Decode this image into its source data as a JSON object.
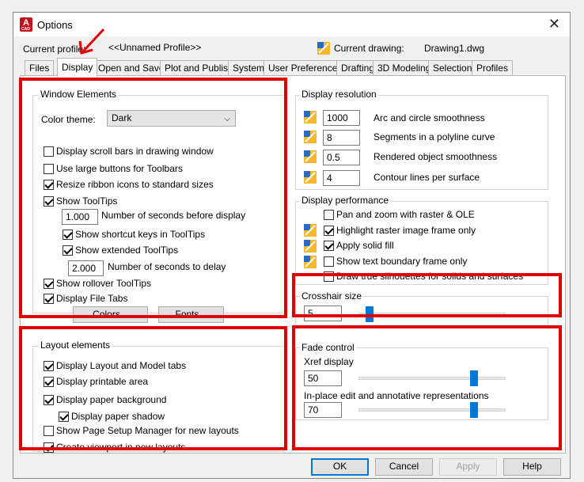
{
  "window": {
    "title": "Options",
    "close": "✕",
    "logo": "A",
    "logo_sub": "CAD"
  },
  "profile": {
    "current_label": "Current profile:",
    "current_value": "<<Unnamed Profile>>",
    "drawing_label": "Current drawing:",
    "drawing_value": "Drawing1.dwg"
  },
  "tabs": [
    "Files",
    "Display",
    "Open and Save",
    "Plot and Publish",
    "System",
    "User Preferences",
    "Drafting",
    "3D Modeling",
    "Selection",
    "Profiles"
  ],
  "window_elements": {
    "title": "Window Elements",
    "color_theme_label": "Color theme:",
    "color_theme_value": "Dark",
    "scroll_bars": "Display scroll bars in drawing window",
    "large_buttons": "Use large buttons for Toolbars",
    "resize_ribbon": "Resize ribbon icons to standard sizes",
    "show_tooltips": "Show ToolTips",
    "seconds_before": "Number of seconds before display",
    "seconds_before_value": "1.000",
    "shortcut_keys": "Show shortcut keys in ToolTips",
    "extended_tooltips": "Show extended ToolTips",
    "seconds_delay": "Number of seconds to delay",
    "seconds_delay_value": "2.000",
    "rollover": "Show rollover ToolTips",
    "file_tabs": "Display File Tabs",
    "colors_button": "Colors...",
    "fonts_button": "Fonts..."
  },
  "layout_elements": {
    "title": "Layout elements",
    "layout_tabs": "Display Layout and Model tabs",
    "printable_area": "Display printable area",
    "paper_background": "Display paper background",
    "paper_shadow": "Display paper shadow",
    "page_setup": "Show Page Setup Manager for new layouts",
    "create_viewport": "Create viewport in new layouts"
  },
  "display_resolution": {
    "title": "Display resolution",
    "items": [
      {
        "value": "1000",
        "label": "Arc and circle smoothness"
      },
      {
        "value": "8",
        "label": "Segments in a polyline curve"
      },
      {
        "value": "0.5",
        "label": "Rendered object smoothness"
      },
      {
        "value": "4",
        "label": "Contour lines per surface"
      }
    ]
  },
  "display_performance": {
    "title": "Display performance",
    "pan_zoom": "Pan and zoom with raster & OLE",
    "highlight_raster": "Highlight raster image frame only",
    "apply_solid": "Apply solid fill",
    "text_boundary": "Show text boundary frame only",
    "silhouettes": "Draw true silhouettes for solids and surfaces"
  },
  "crosshair": {
    "title": "Crosshair size",
    "value": "5",
    "level": 0.05
  },
  "fade": {
    "title": "Fade control",
    "xref_label": "Xref display",
    "xref_value": "50",
    "xref_level": 0.8,
    "inplace_label": "In-place edit and annotative representations",
    "inplace_value": "70",
    "inplace_level": 0.8
  },
  "buttons": {
    "ok": "OK",
    "cancel": "Cancel",
    "apply": "Apply",
    "help": "Help"
  },
  "colors": {
    "highlight": "#e00000",
    "accent": "#0078d7"
  }
}
